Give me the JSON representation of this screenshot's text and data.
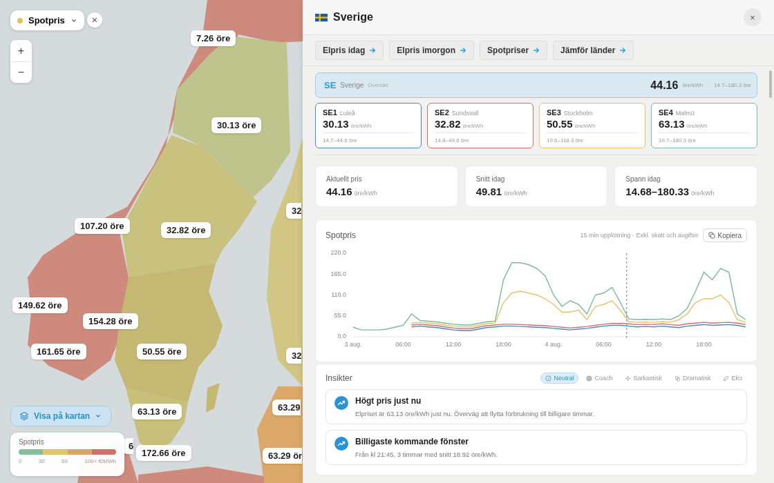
{
  "map": {
    "picture": {
      "kind": "picture"
    },
    "layer_select": {
      "label": "Spotpris",
      "color": "#e0c15a"
    },
    "close": "×",
    "zoom": [
      "+",
      "−"
    ],
    "price_labels": [
      "7.26 öre",
      "30.13 öre",
      "107.20 öre",
      "32.82 öre",
      "32",
      "149.62 öre",
      "154.28 öre",
      "161.65 öre",
      "50.55 öre",
      "32",
      "63.29",
      "63.13 öre",
      "6",
      "172.66 öre",
      "63.29 ör"
    ],
    "show_on_map": {
      "label": "Visa på kartan"
    },
    "legend": {
      "title": "Spotpris",
      "segments": [
        {
          "color": "#84bf9d"
        },
        {
          "color": "#e2c46a"
        },
        {
          "color": "#dca46a"
        },
        {
          "color": "#c9736a"
        }
      ],
      "ticks": [
        "0",
        "30",
        "60",
        "100+ €/MWh"
      ]
    }
  },
  "panel": {
    "title": "Sverige",
    "close": "×",
    "links": [
      "Elpris idag",
      "Elpris imorgon",
      "Spotpriser",
      "Jämför länder"
    ],
    "overview": {
      "code": "SE",
      "name": "Sverige",
      "tag": "Oversikt",
      "price": "44.16",
      "unit": "öre/kWh",
      "range": "14.7–180.3 öre",
      "selected": true
    },
    "zones": [
      {
        "code": "SE1",
        "city": "Luleå",
        "price": "30.13",
        "unit": "öre/kWh",
        "range": "14.7–44.6 öre",
        "color": "#4f86b8",
        "selected": false
      },
      {
        "code": "SE2",
        "city": "Sundsvall",
        "price": "32.82",
        "unit": "öre/kWh",
        "range": "14.8–49.6 öre",
        "color": "#c9706a",
        "selected": false
      },
      {
        "code": "SE3",
        "city": "Stockholm",
        "price": "50.55",
        "unit": "öre/kWh",
        "range": "19.6–118.3 öre",
        "color": "#e3c46a",
        "selected": false
      },
      {
        "code": "SE4",
        "city": "Malmö",
        "price": "63.13",
        "unit": "öre/kWh",
        "range": "19.7–180.3 öre",
        "color": "#7bb89a",
        "selected": false
      }
    ],
    "stats": [
      {
        "label": "Aktuellt pris",
        "value": "44.16",
        "unit": "öre/kWh"
      },
      {
        "label": "Snitt idag",
        "value": "49.81",
        "unit": "öre/kWh"
      },
      {
        "label": "Spann idag",
        "value": "14.68–180.33",
        "unit": "öre/kWh"
      }
    ],
    "chart": {
      "title": "Spotpris",
      "note": "15 min upplösning · Exkl. skatt och avgifter",
      "copy": "Kopiera",
      "next_day_ticks": [
        "06:00",
        "12:00",
        "18:00"
      ],
      "chart_data": {
        "type": "line",
        "x": [
          0,
          1,
          2,
          3,
          4,
          5,
          6,
          7,
          8,
          9,
          10,
          11,
          12,
          13,
          14,
          15,
          16,
          17,
          18,
          19,
          20,
          21,
          22,
          23,
          24,
          25,
          26,
          27,
          28,
          29,
          30,
          31,
          32,
          33,
          34,
          35,
          36,
          37,
          38,
          39,
          40,
          41,
          42,
          43,
          44,
          45,
          46,
          47
        ],
        "xlim": [
          0,
          47
        ],
        "ylim": [
          0,
          220
        ],
        "yticks": [
          {
            "value": 0,
            "label": "0.0"
          },
          {
            "value": 55,
            "label": "55.0"
          },
          {
            "value": 110,
            "label": "110.0"
          },
          {
            "value": 165,
            "label": "165.0"
          },
          {
            "value": 220,
            "label": "220.0"
          }
        ],
        "xticks": [
          {
            "value": 0,
            "label": "3 aug."
          },
          {
            "value": 6,
            "label": "06:00"
          },
          {
            "value": 12,
            "label": "12:00"
          },
          {
            "value": 18,
            "label": "18:00"
          },
          {
            "value": 24,
            "label": "4 aug."
          }
        ],
        "series": [
          {
            "color": "#4f86b8",
            "values": [
              null,
              null,
              null,
              null,
              null,
              null,
              null,
              26,
              28,
              26,
              24,
              21,
              18,
              16,
              16,
              20,
              24,
              26,
              28,
              28,
              27,
              26,
              25,
              24,
              22,
              20,
              18,
              20,
              22,
              25,
              28,
              30,
              30,
              28,
              26,
              27,
              26,
              28,
              26,
              24,
              28,
              30,
              32,
              30,
              31,
              32,
              30,
              26
            ]
          },
          {
            "color": "#c9706a",
            "values": [
              null,
              null,
              null,
              null,
              null,
              null,
              null,
              31,
              33,
              31,
              29,
              26,
              23,
              21,
              21,
              25,
              29,
              31,
              33,
              33,
              32,
              31,
              30,
              29,
              27,
              25,
              23,
              25,
              27,
              30,
              33,
              35,
              35,
              34,
              32,
              33,
              32,
              34,
              32,
              30,
              34,
              36,
              38,
              36,
              37,
              38,
              36,
              32
            ]
          },
          {
            "color": "#e3c46a",
            "values": [
              null,
              null,
              null,
              null,
              null,
              null,
              null,
              36,
              38,
              36,
              34,
              31,
              28,
              26,
              26,
              30,
              34,
              36,
              90,
              115,
              120,
              115,
              110,
              100,
              85,
              65,
              65,
              70,
              45,
              80,
              85,
              95,
              70,
              40,
              38,
              39,
              38,
              40,
              38,
              45,
              60,
              90,
              100,
              100,
              110,
              90,
              45,
              38
            ]
          },
          {
            "color": "#7bb89a",
            "values": [
              25,
              18,
              18,
              18,
              20,
              25,
              30,
              60,
              43,
              41,
              39,
              36,
              33,
              31,
              31,
              35,
              39,
              41,
              150,
              195,
              195,
              190,
              180,
              160,
              110,
              80,
              95,
              85,
              60,
              110,
              115,
              130,
              90,
              47,
              45,
              46,
              45,
              47,
              45,
              55,
              75,
              120,
              170,
              150,
              180,
              170,
              60,
              45
            ]
          }
        ],
        "ref_lines": [
          {
            "axis": "x",
            "value": 32.75
          }
        ]
      }
    },
    "insights": {
      "title": "Insikter",
      "tones": [
        {
          "label": "Neutral",
          "kind": "info",
          "selected": true
        },
        {
          "label": "Coach",
          "kind": "coach",
          "selected": false
        },
        {
          "label": "Sarkastisk",
          "kind": "sparkle",
          "selected": false
        },
        {
          "label": "Dramatisk",
          "kind": "drama",
          "selected": false
        },
        {
          "label": "Eko",
          "kind": "leaf",
          "selected": false
        }
      ],
      "items": [
        {
          "title": "Högt pris just nu",
          "text": "Elpriset är 63.13 öre/kWh just nu. Överväg att flytta förbrukning till billigare timmar."
        },
        {
          "title": "Billigaste kommande fönster",
          "text": "Från kl 21:45, 3 timmar med snitt 18.92 öre/kWh."
        }
      ]
    }
  }
}
